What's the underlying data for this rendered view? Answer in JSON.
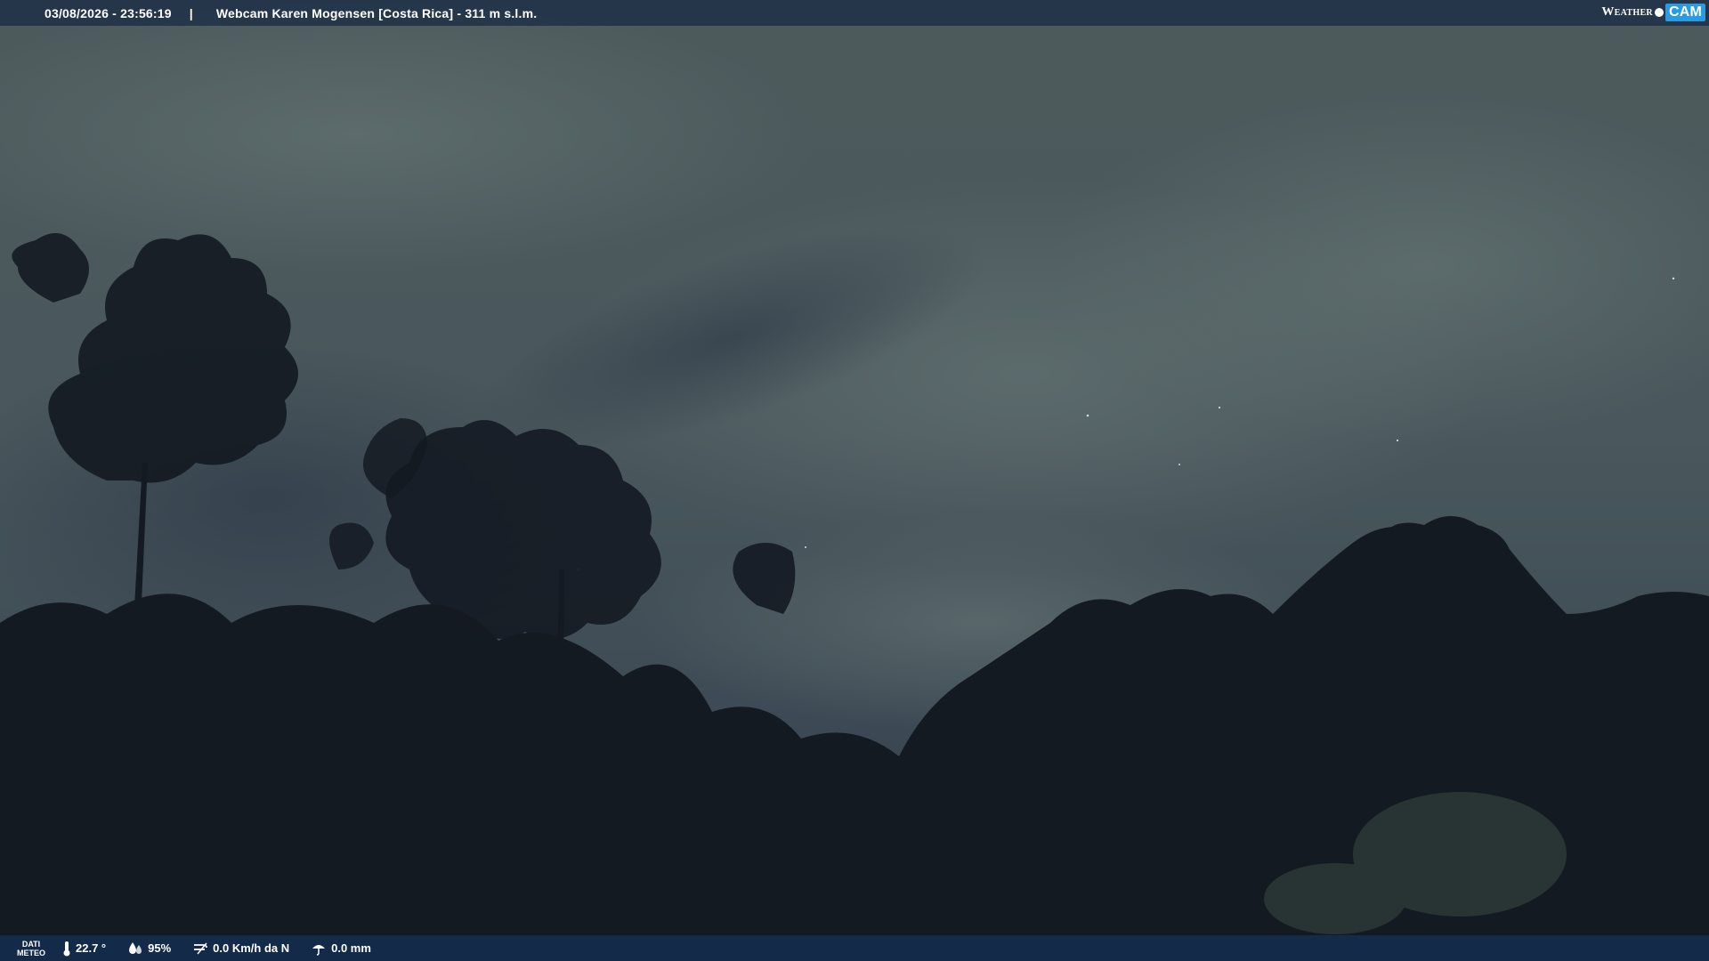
{
  "header": {
    "datetime": "03/08/2026 - 23:56:19",
    "separator": "|",
    "title": "Webcam Karen Mogensen [Costa Rica] - 311 m s.l.m.",
    "brand_weather": "Weather",
    "brand_cam": "CAM"
  },
  "footer": {
    "label_line1": "DATI",
    "label_line2": "METEO",
    "temperature": "22.7 °",
    "humidity": "95%",
    "wind": "0.0 Km/h da N",
    "rain": "0.0 mm"
  },
  "colors": {
    "sky": "#4a5a60",
    "foliage": "#141a22",
    "bar": "#1e3046",
    "brand_accent": "#2a9be0"
  },
  "icons": [
    "thermometer-icon",
    "humidity-icon",
    "wind-icon",
    "rain-icon"
  ]
}
